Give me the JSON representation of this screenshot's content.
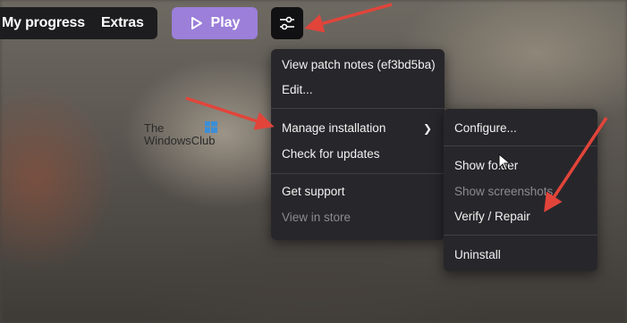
{
  "topbar": {
    "tab_progress": "My progress",
    "tab_extras": "Extras",
    "play_label": "Play"
  },
  "menu": {
    "items": [
      {
        "label": "View patch notes (ef3bd5ba)"
      },
      {
        "label": "Edit..."
      },
      {
        "label": "Manage installation"
      },
      {
        "label": "Check for updates"
      },
      {
        "label": "Get support"
      },
      {
        "label": "View in store"
      }
    ]
  },
  "submenu": {
    "items": [
      {
        "label": "Configure..."
      },
      {
        "label": "Show folder"
      },
      {
        "label": "Show screenshots"
      },
      {
        "label": "Verify / Repair"
      },
      {
        "label": "Uninstall"
      }
    ]
  },
  "watermark": {
    "line1": "The",
    "line2": "WindowsClub"
  },
  "colors": {
    "play_accent": "#9b7fd9",
    "menu_bg": "#27272b",
    "arrow_red": "#e2443a"
  },
  "icons": {
    "play": "play-icon",
    "settings": "sliders-icon",
    "submenu": "chevron-right-icon"
  }
}
